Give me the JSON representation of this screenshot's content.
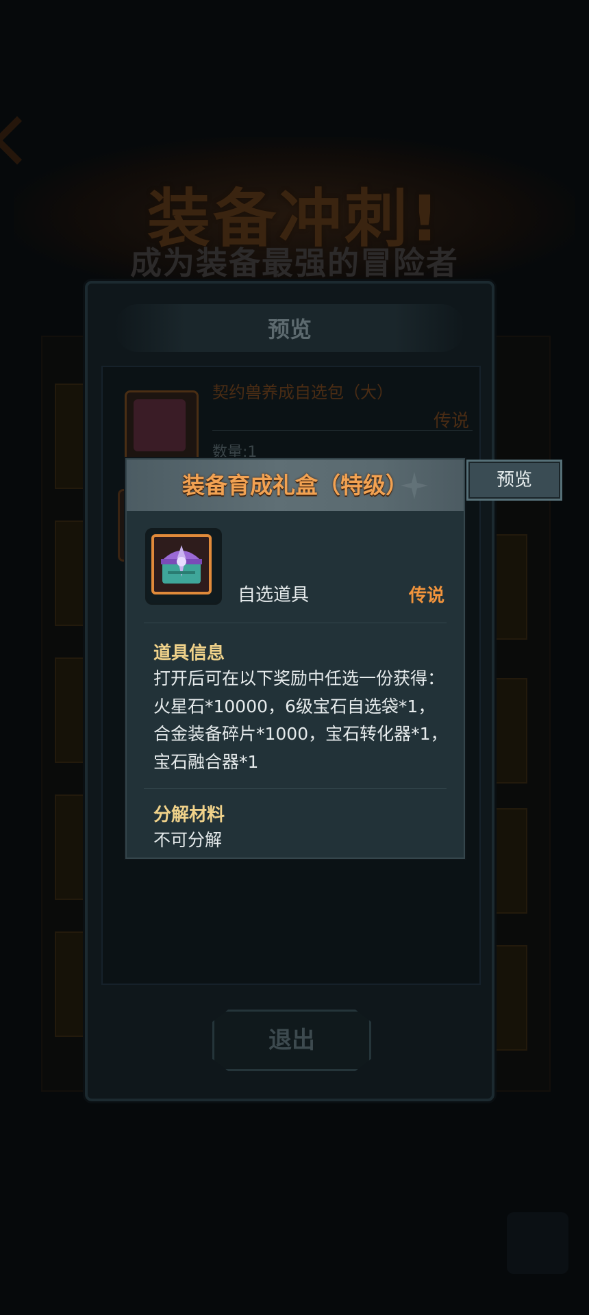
{
  "background": {
    "banner_title": "装备冲刺!",
    "banner_subtitle": "成为装备最强的冒险者"
  },
  "preview_panel": {
    "title": "预览",
    "item": {
      "name": "契约兽养成自选包（大）",
      "rarity": "传说",
      "quantity": "数量:1"
    },
    "exit_label": "退出"
  },
  "detail_popup": {
    "title": "装备育成礼盒（特级）",
    "item_type": "自选道具",
    "rarity": "传说",
    "info_heading": "道具信息",
    "info_text": "打开后可在以下奖励中任选一份获得：火星石*10000，6级宝石自选袋*1，合金装备碎片*1000，宝石转化器*1，宝石融合器*1",
    "decompose_heading": "分解材料",
    "decompose_value": "不可分解",
    "rarity_color": "#f2943c",
    "title_color": "#f2a252"
  },
  "side_button": {
    "label": "预览"
  },
  "icons": [
    "treasure-chest-icon",
    "gift-box-icon",
    "back-arrow-icon"
  ]
}
